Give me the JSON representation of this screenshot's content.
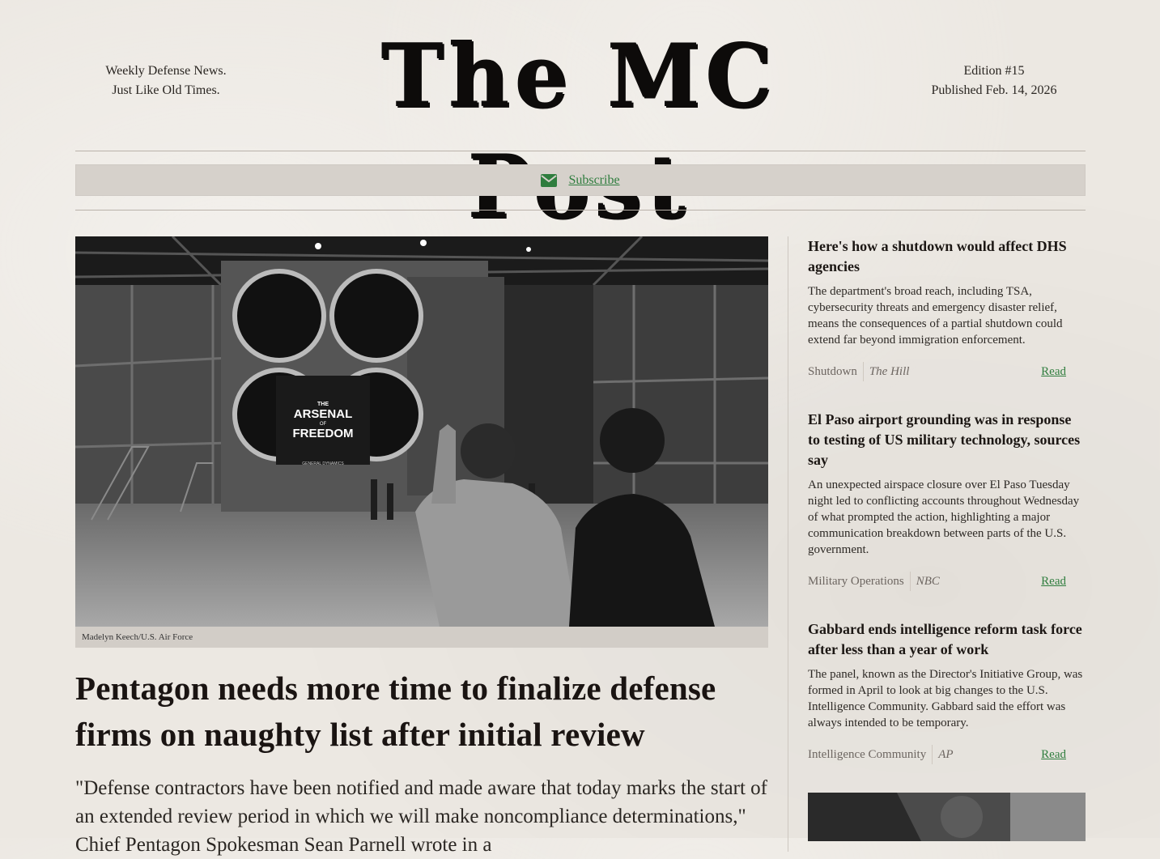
{
  "header": {
    "tagline_line1": "Weekly Defense News.",
    "tagline_line2": "Just Like Old Times.",
    "masthead": "The MC Post",
    "edition": "Edition #15",
    "published": "Published Feb. 14, 2026"
  },
  "subscribe": {
    "icon": "envelope-icon",
    "label": "Subscribe",
    "color": "#2f7d3e"
  },
  "main_story": {
    "image_banner_lines": [
      "THE",
      "ARSENAL",
      "OF",
      "FREEDOM",
      "GENERAL DYNAMICS"
    ],
    "caption": "Madelyn Keech/U.S. Air Force",
    "title": "Pentagon needs more time to finalize defense firms on naughty list after initial review",
    "lede": "\"Defense contractors have been notified and made aware that today marks the start of an extended review period in which we will make noncompliance determinations,\" Chief Pentagon Spokesman Sean Parnell wrote in a"
  },
  "sidebar": {
    "stories": [
      {
        "title": "Here's how a shutdown would affect DHS agencies",
        "body": "The department's broad reach, including TSA, cybersecurity threats and emergency disaster relief, means the consequences of a partial shutdown could extend far beyond immigration enforcement.",
        "tag": "Shutdown",
        "source": "The Hill",
        "read": "Read"
      },
      {
        "title": "El Paso airport grounding was in response to testing of US military technology, sources say",
        "body": "An unexpected airspace closure over El Paso Tuesday night led to conflicting accounts throughout Wednesday of what prompted the action, highlighting a major communication breakdown between parts of the U.S. government.",
        "tag": "Military Operations",
        "source": "NBC",
        "read": "Read"
      },
      {
        "title": "Gabbard ends intelligence reform task force after less than a year of work",
        "body": "The panel, known as the Director's Initiative Group, was formed in April to look at big changes to the U.S. Intelligence Community. Gabbard said the effort was always intended to be temporary.",
        "tag": "Intelligence Community",
        "source": "AP",
        "read": "Read"
      }
    ]
  },
  "colors": {
    "accent_green": "#2f7d3e",
    "paper": "#ece8e2",
    "ink": "#1a1412"
  }
}
